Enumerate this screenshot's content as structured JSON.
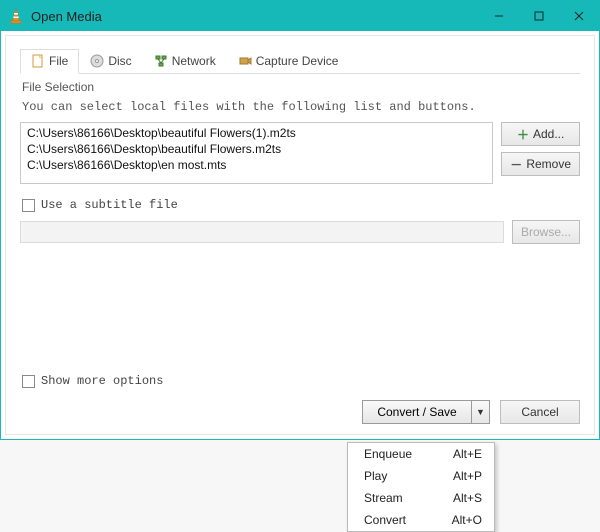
{
  "window": {
    "title": "Open Media"
  },
  "tabs": {
    "file": "File",
    "disc": "Disc",
    "network": "Network",
    "capture": "Capture Device"
  },
  "fileSelection": {
    "heading": "File Selection",
    "help": "You can select local files with the following list and buttons.",
    "items": [
      "C:\\Users\\86166\\Desktop\\beautiful Flowers(1).m2ts",
      "C:\\Users\\86166\\Desktop\\beautiful Flowers.m2ts",
      "C:\\Users\\86166\\Desktop\\en most.mts"
    ],
    "addLabel": "Add...",
    "removeLabel": "Remove"
  },
  "subtitle": {
    "checkboxLabel": "Use a subtitle file",
    "browseLabel": "Browse...",
    "path": ""
  },
  "moreOptions": {
    "label": "Show more options"
  },
  "footer": {
    "convertSave": "Convert / Save",
    "cancel": "Cancel"
  },
  "dropdown": [
    {
      "label": "Enqueue",
      "shortcut": "Alt+E"
    },
    {
      "label": "Play",
      "shortcut": "Alt+P"
    },
    {
      "label": "Stream",
      "shortcut": "Alt+S"
    },
    {
      "label": "Convert",
      "shortcut": "Alt+O"
    }
  ],
  "icons": {
    "plus": "＋",
    "minus": "－",
    "caret": "▼"
  }
}
